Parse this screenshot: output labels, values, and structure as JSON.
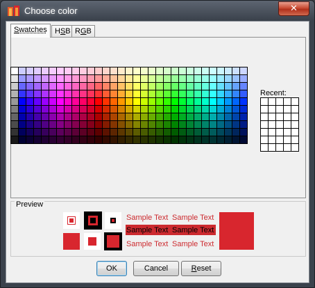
{
  "window": {
    "title": "Choose color",
    "close_glyph": "✕"
  },
  "tabs": [
    {
      "label": "Swatches",
      "mnemonic_index": 0,
      "active": true
    },
    {
      "label": "HSB",
      "mnemonic_index": 1,
      "active": false
    },
    {
      "label": "RGB",
      "mnemonic_index": 1,
      "active": false
    }
  ],
  "swatches": {
    "recent_label": "Recent:",
    "rows": 10,
    "cols": 31,
    "recent_rows": 7,
    "recent_cols": 5
  },
  "preview": {
    "label": "Preview",
    "sample_text": "Sample Text",
    "selected_color": "#d8262e",
    "selected_dark": "#cc2a2f"
  },
  "buttons": {
    "ok": "OK",
    "cancel": "Cancel",
    "reset": "Reset"
  },
  "icons": {
    "app": "app-logo-icon",
    "close": "close-icon"
  }
}
